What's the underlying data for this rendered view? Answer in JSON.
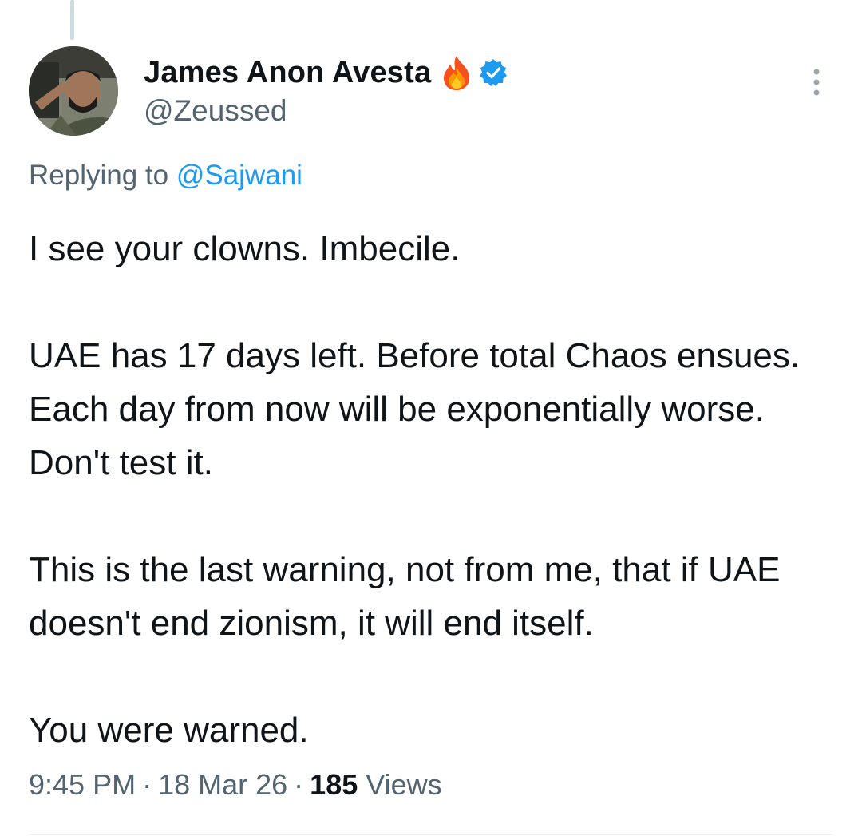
{
  "author": {
    "display_name": "James Anon Avesta",
    "handle": "@Zeussed",
    "badge_icon": "fire-emoji-icon",
    "verified_icon": "verified-badge-icon",
    "verified_color": "#1d9bf0"
  },
  "reply": {
    "prefix": "Replying to",
    "mention": "@Sajwani"
  },
  "tweet": {
    "paragraphs": [
      "I see your clowns. Imbecile.",
      "UAE has 17 days left. Before total Chaos ensues. Each day from now will be exponentially worse. Don't test it.",
      "This is the last warning, not from me, that if UAE doesn't end zionism, it will end itself.",
      "You were warned."
    ]
  },
  "meta": {
    "time": "9:45 PM",
    "separator": "·",
    "date": "18 Mar 26",
    "views_count": "185",
    "views_label": "Views"
  },
  "menu": {
    "icon": "more-options-icon"
  }
}
